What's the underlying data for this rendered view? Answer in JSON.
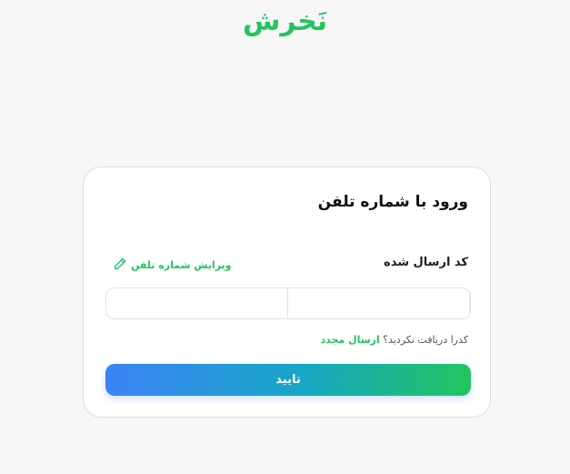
{
  "brand": {
    "logo_text": "نَخرش",
    "color": "#22c55e"
  },
  "login": {
    "title": "ورود با شماره تلفن",
    "code_label": "کد ارسال شده",
    "edit_phone_label": "ویرایش شماره تلفن",
    "edit_icon": "pencil-icon",
    "otp_cells": [
      "",
      "",
      "",
      "",
      "",
      ""
    ],
    "resend_prompt": "کدرا دریافت نکردید؟",
    "resend_link": "ارسال مجدد",
    "submit_label": "تایید"
  },
  "colors": {
    "accent_green": "#22c55e",
    "gradient_start": "#3b82f6",
    "gradient_end": "#22c55e"
  }
}
